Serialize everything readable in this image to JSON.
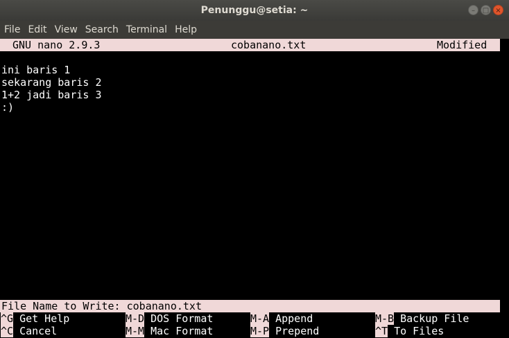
{
  "window": {
    "title": "Penunggu@setia: ~",
    "buttons": [
      {
        "name": "minimize-icon",
        "glyph": "–"
      },
      {
        "name": "maximize-icon",
        "glyph": "□"
      },
      {
        "name": "close-icon",
        "glyph": "×"
      }
    ]
  },
  "menubar": [
    "File",
    "Edit",
    "View",
    "Search",
    "Terminal",
    "Help"
  ],
  "nano": {
    "version": "GNU nano 2.9.3",
    "filename": "cobanano.txt",
    "status": "Modified",
    "lines": [
      "ini baris 1",
      "sekarang baris 2",
      "1+2 jadi baris 3",
      ":)"
    ],
    "prompt": "File Name to Write: cobanano.txt",
    "shortcuts_row1": [
      {
        "key": "^G",
        "label": "Get Help"
      },
      {
        "key": "M-D",
        "label": "DOS Format"
      },
      {
        "key": "M-A",
        "label": "Append"
      },
      {
        "key": "M-B",
        "label": "Backup File"
      }
    ],
    "shortcuts_row2": [
      {
        "key": "^C",
        "label": "Cancel"
      },
      {
        "key": "M-M",
        "label": "Mac Format"
      },
      {
        "key": "M-P",
        "label": "Prepend"
      },
      {
        "key": "^T",
        "label": "To Files"
      }
    ]
  },
  "colors": {
    "titlebar": "#3c3b37",
    "terminal_bg": "#000000",
    "highlight_bar": "#f0d8d8",
    "close_button": "#e0552c"
  }
}
